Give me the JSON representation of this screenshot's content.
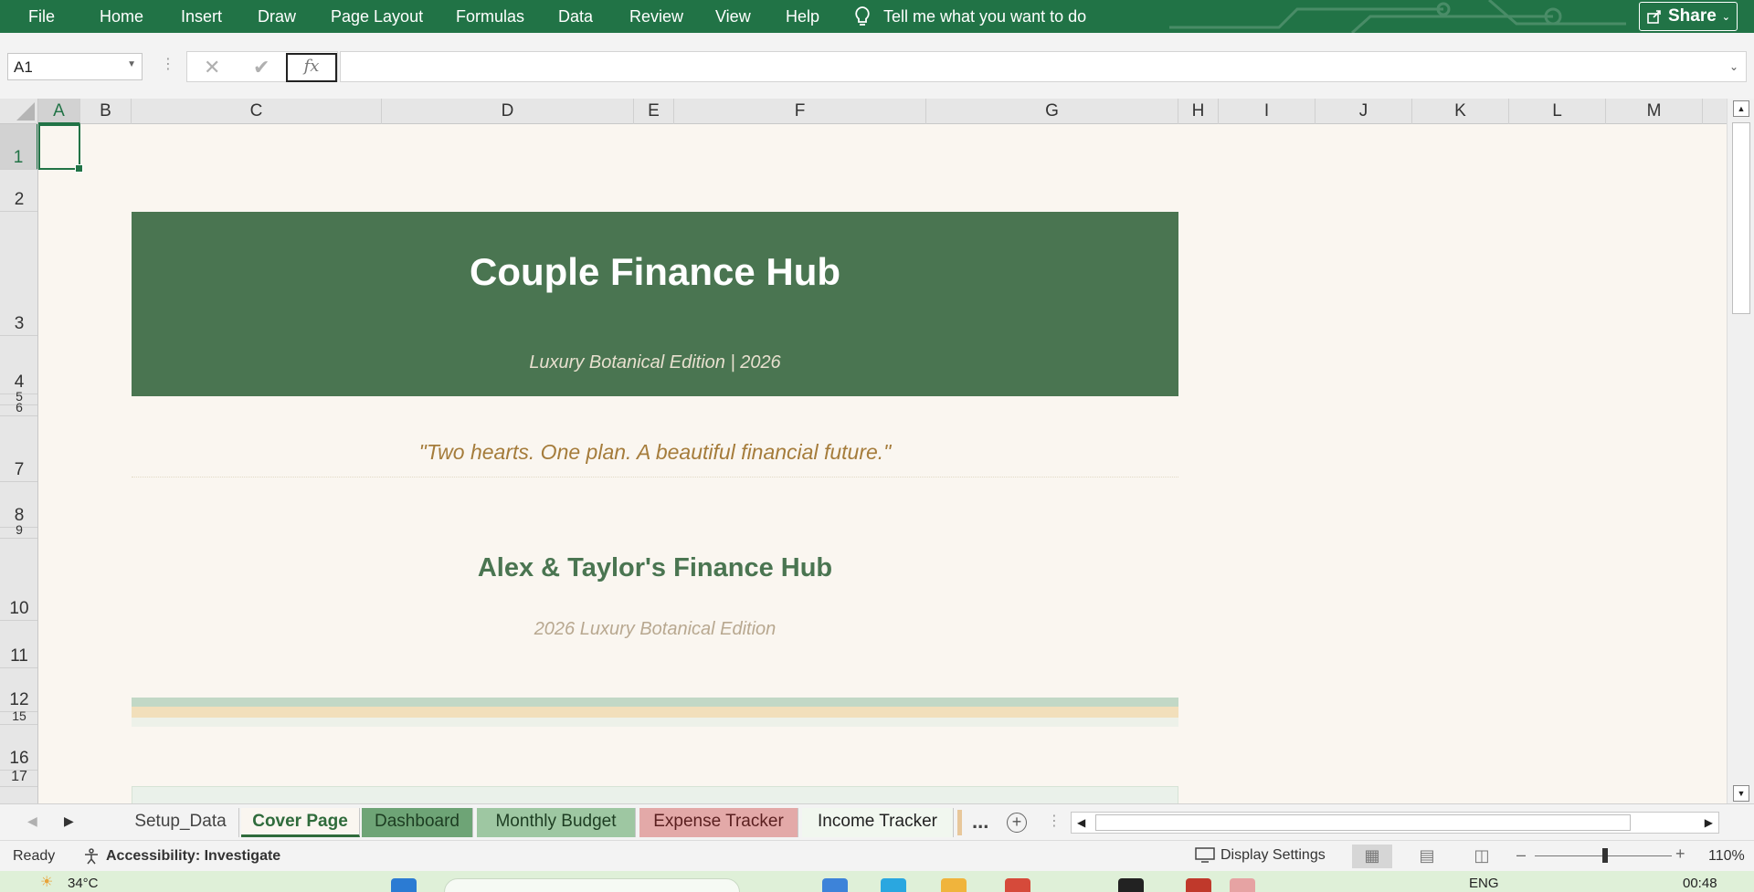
{
  "menu": {
    "items": [
      "File",
      "Home",
      "Insert",
      "Draw",
      "Page Layout",
      "Formulas",
      "Data",
      "Review",
      "View",
      "Help"
    ],
    "tell_me": "Tell me what you want to do",
    "share": "Share"
  },
  "formula_bar": {
    "name_box": "A1",
    "fx": "fx",
    "formula": ""
  },
  "grid": {
    "columns": [
      "A",
      "B",
      "C",
      "D",
      "E",
      "F",
      "G",
      "H",
      "I",
      "J",
      "K",
      "L",
      "M"
    ],
    "active_column": "A",
    "rows": [
      "1",
      "2",
      "3",
      "4",
      "5",
      "6",
      "7",
      "8",
      "9",
      "10",
      "11",
      "12",
      "15",
      "16",
      "17"
    ],
    "active_row": "1"
  },
  "sheet": {
    "title": "Couple Finance Hub",
    "subtitle": "Luxury Botanical Edition  |  2026",
    "quote": "\"Two hearts. One plan. A beautiful financial future.\"",
    "names": "Alex  &  Taylor's Finance Hub",
    "edition": "2026 Luxury Botanical Edition",
    "colors": {
      "hero": "#4a7551",
      "canvas": "#faf6f0",
      "quote": "#a57c3b",
      "names": "#4a7551"
    }
  },
  "tabs": {
    "items": [
      "Setup_Data",
      "Cover Page",
      "Dashboard",
      "Monthly Budget",
      "Expense Tracker",
      "Income Tracker"
    ],
    "active": "Cover Page",
    "more": "..."
  },
  "status": {
    "ready": "Ready",
    "accessibility": "Accessibility: Investigate",
    "display_settings": "Display Settings",
    "zoom": "110%"
  },
  "taskbar": {
    "temperature": "34°C",
    "language": "ENG",
    "time": "00:48"
  }
}
